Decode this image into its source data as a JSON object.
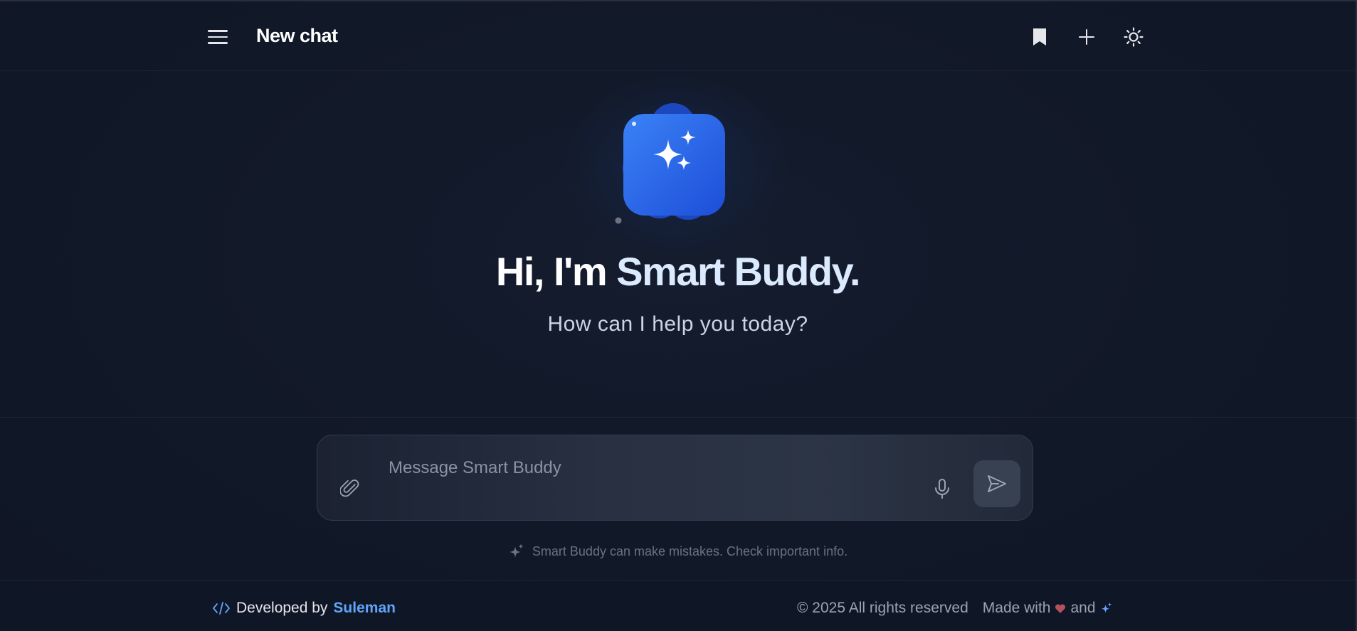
{
  "header": {
    "title": "New chat",
    "menu_icon": "hamburger-menu-icon",
    "bookmark_icon": "bookmark-icon",
    "new_chat_icon": "plus-icon",
    "theme_icon": "sun-icon"
  },
  "hero": {
    "greeting_prefix": "Hi, I'm ",
    "greeting_name": "Smart Buddy.",
    "subtitle": "How can I help you today?",
    "logo_icon": "sparkles-icon"
  },
  "composer": {
    "placeholder": "Message Smart Buddy",
    "value": "",
    "attach_icon": "paperclip-icon",
    "mic_icon": "microphone-icon",
    "send_icon": "send-icon"
  },
  "disclaimer": {
    "text": "Smart Buddy can make mistakes. Check important info.",
    "icon": "sparkles-icon"
  },
  "footer": {
    "developed_by": "Developed by",
    "developer": "Suleman",
    "copyright": "© 2025 All rights reserved",
    "made_with": "Made with",
    "and": "and"
  },
  "colors": {
    "background": "#111827",
    "accent": "#2563eb",
    "link": "#60a5fa",
    "heart": "#b4505a"
  }
}
